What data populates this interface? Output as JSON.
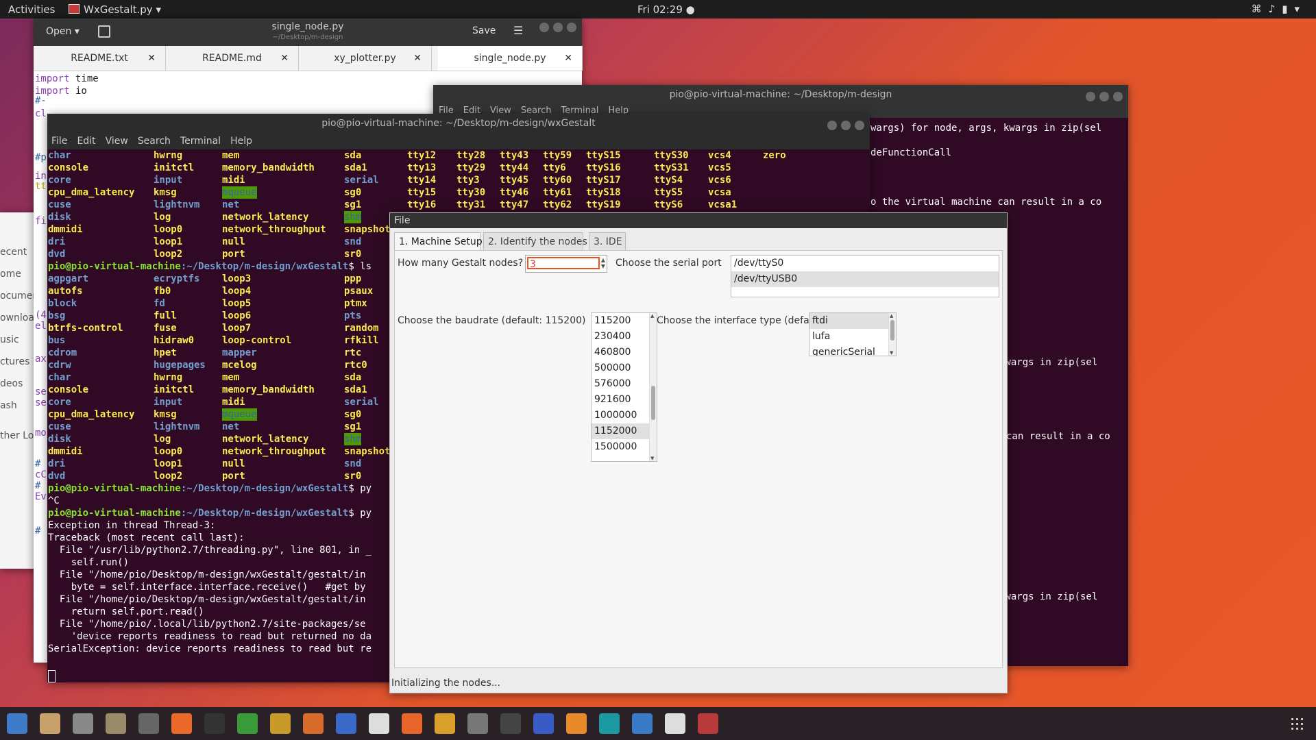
{
  "topbar": {
    "activities": "Activities",
    "app_name": "WxGestalt.py",
    "clock": "Fri 02:29",
    "tray_icons": [
      "network-icon",
      "volume-icon",
      "power-icon"
    ]
  },
  "gedit": {
    "open_label": "Open",
    "title": "single_node.py",
    "subtitle": "~/Desktop/m-design",
    "save_label": "Save",
    "tabs": [
      {
        "label": "README.txt"
      },
      {
        "label": "README.md"
      },
      {
        "label": "xy_plotter.py"
      },
      {
        "label": "single_node.py"
      }
    ],
    "code": [
      {
        "kw": "import",
        "rest": " time"
      },
      {
        "kw": "import",
        "rest": " io"
      }
    ],
    "left_fragments": [
      "#-",
      "cl",
      "#p",
      "in",
      "tt",
      "fi",
      "(4",
      "el",
      "ax",
      "se",
      "se",
      "mo",
      "#",
      "cC",
      "#",
      "Ev",
      "#"
    ]
  },
  "nautilus": {
    "items": [
      "ecent",
      "ome",
      "ocumen",
      "ownloa",
      "usic",
      "ctures",
      "deos",
      "ash",
      "ther Loc"
    ]
  },
  "term_back": {
    "title": "pio@pio-virtual-machine: ~/Desktop/m-design",
    "menu": [
      "File",
      "Edit",
      "View",
      "Search",
      "Terminal",
      "Help"
    ],
    "lines": [
      "wargs) for node, args, kwargs in zip(sel",
      "deFunctionCall",
      "o the virtual machine can result in a co",
      "kwargs in zip(sel",
      "can result in a co",
      "kwargs in zip(sel"
    ]
  },
  "term_front": {
    "title": "pio@pio-virtual-machine: ~/Desktop/m-design/wxGestalt",
    "menu": [
      "File",
      "Edit",
      "View",
      "Search",
      "Terminal",
      "Help"
    ],
    "dev_rows_1": [
      [
        "char",
        "hwrng",
        "mem",
        "sda",
        "tty12",
        "tty28",
        "tty43",
        "tty59",
        "ttyS15",
        "ttyS30",
        "vcs4",
        "zero"
      ],
      [
        "console",
        "initctl",
        "memory_bandwidth",
        "sda1",
        "tty13",
        "tty29",
        "tty44",
        "tty6",
        "ttyS16",
        "ttyS31",
        "vcs5",
        ""
      ],
      [
        "core",
        "input",
        "midi",
        "serial",
        "tty14",
        "tty3",
        "tty45",
        "tty60",
        "ttyS17",
        "ttyS4",
        "vcs6",
        ""
      ],
      [
        "cpu_dma_latency",
        "kmsg",
        "mqueue",
        "sg0",
        "tty15",
        "tty30",
        "tty46",
        "tty61",
        "ttyS18",
        "ttyS5",
        "vcsa",
        ""
      ],
      [
        "cuse",
        "lightnvm",
        "net",
        "sg1",
        "tty16",
        "tty31",
        "tty47",
        "tty62",
        "ttyS19",
        "ttyS6",
        "vcsa1",
        ""
      ],
      [
        "disk",
        "log",
        "network_latency",
        "shm",
        "",
        "",
        "",
        "",
        "",
        "",
        "",
        ""
      ],
      [
        "dmmidi",
        "loop0",
        "network_throughput",
        "snapshot",
        "",
        "",
        "",
        "",
        "",
        "",
        "",
        ""
      ],
      [
        "dri",
        "loop1",
        "null",
        "snd",
        "",
        "",
        "",
        "",
        "",
        "",
        "",
        ""
      ],
      [
        "dvd",
        "loop2",
        "port",
        "sr0",
        "",
        "",
        "",
        "",
        "",
        "",
        "",
        ""
      ]
    ],
    "prompt1": "pio@pio-virtual-machine:~/Desktop/m-design/wxGestalt$ ls",
    "dev_rows_2": [
      [
        "agpgart",
        "ecryptfs",
        "loop3",
        "ppp"
      ],
      [
        "autofs",
        "fb0",
        "loop4",
        "psaux"
      ],
      [
        "block",
        "fd",
        "loop5",
        "ptmx"
      ],
      [
        "bsg",
        "full",
        "loop6",
        "pts"
      ],
      [
        "btrfs-control",
        "fuse",
        "loop7",
        "random"
      ],
      [
        "bus",
        "hidraw0",
        "loop-control",
        "rfkill"
      ],
      [
        "cdrom",
        "hpet",
        "mapper",
        "rtc"
      ],
      [
        "cdrw",
        "hugepages",
        "mcelog",
        "rtc0"
      ],
      [
        "char",
        "hwrng",
        "mem",
        "sda"
      ],
      [
        "console",
        "initctl",
        "memory_bandwidth",
        "sda1"
      ],
      [
        "core",
        "input",
        "midi",
        "serial"
      ],
      [
        "cpu_dma_latency",
        "kmsg",
        "mqueue",
        "sg0"
      ],
      [
        "cuse",
        "lightnvm",
        "net",
        "sg1"
      ],
      [
        "disk",
        "log",
        "network_latency",
        "shm"
      ],
      [
        "dmmidi",
        "loop0",
        "network_throughput",
        "snapshot"
      ],
      [
        "dri",
        "loop1",
        "null",
        "snd"
      ],
      [
        "dvd",
        "loop2",
        "port",
        "sr0"
      ]
    ],
    "prompt2": "pio@pio-virtual-machine:~/Desktop/m-design/wxGestalt$ py",
    "ctrl_c": "^C",
    "prompt3": "pio@pio-virtual-machine:~/Desktop/m-design/wxGestalt$ py",
    "traceback": [
      "Exception in thread Thread-3:",
      "Traceback (most recent call last):",
      "  File \"/usr/lib/python2.7/threading.py\", line 801, in _",
      "    self.run()",
      "  File \"/home/pio/Desktop/m-design/wxGestalt/gestalt/in",
      "    byte = self.interface.interface.receive()   #get by",
      "  File \"/home/pio/Desktop/m-design/wxGestalt/gestalt/in",
      "    return self.port.read()",
      "  File \"/home/pio/.local/lib/python2.7/site-packages/se",
      "    'device reports readiness to read but returned no da",
      "SerialException: device reports readiness to read but re"
    ]
  },
  "dialog": {
    "menu": "File",
    "tabs": [
      "1. Machine Setup",
      "2. Identify the nodes",
      "3. IDE"
    ],
    "nodes_label": "How many Gestalt nodes?",
    "nodes_value": "3",
    "serial_label": "Choose the serial port",
    "serial_ports": [
      "/dev/ttyS0",
      "/dev/ttyUSB0"
    ],
    "baud_label": "Choose the baudrate (default: 115200)",
    "baudrates": [
      "115200",
      "230400",
      "460800",
      "500000",
      "576000",
      "921600",
      "1000000",
      "1152000",
      "1500000"
    ],
    "iface_label": "Choose the interface type (default: ftdi)",
    "interfaces": [
      "ftdi",
      "lufa",
      "genericSerial"
    ],
    "status": "Initializing the nodes..."
  }
}
